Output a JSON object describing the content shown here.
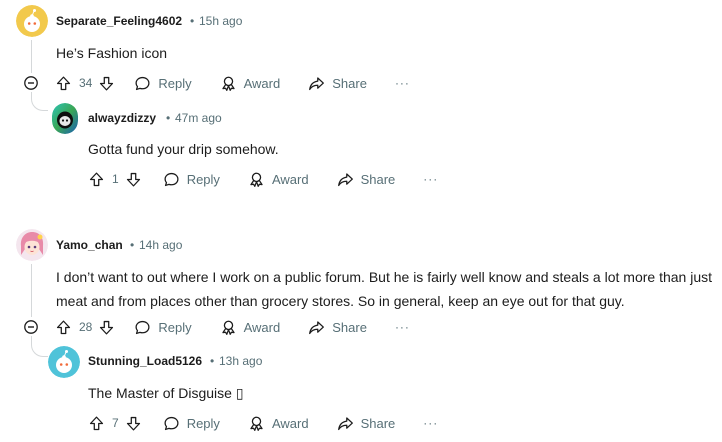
{
  "comments": [
    {
      "username": "Separate_Feeling4602",
      "time": "15h ago",
      "body": "He’s Fashion icon",
      "votes": "34",
      "avatar_icon": "snoo-avatar-yellow",
      "reply": {
        "username": "alwayzdizzy",
        "time": "47m ago",
        "body": "Gotta fund your drip somehow.",
        "votes": "1",
        "avatar_icon": "snoo-avatar-green-gradient"
      }
    },
    {
      "username": "Yamo_chan",
      "time": "14h ago",
      "body_lines": [
        "I don’t want to out where I work on a public forum. But he is fairly well know and steals a lot more than just",
        "meat and from places other than grocery stores. So in general, keep an eye out for that guy."
      ],
      "votes": "28",
      "avatar_icon": "anime-character-avatar",
      "reply": {
        "username": "Stunning_Load5126",
        "time": "13h ago",
        "body": "The Master of Disguise ",
        "emoji_placeholder": "▯",
        "votes": "7",
        "avatar_icon": "snoo-avatar-teal"
      }
    }
  ],
  "actions": {
    "reply": "Reply",
    "award": "Award",
    "share": "Share",
    "more": "···",
    "dot": "•"
  },
  "colors": {
    "meta": "#576f76",
    "thread_line": "#d5d8da",
    "avatar_yellow": "#f2c94c",
    "avatar_teal": "#4fc3d9"
  }
}
